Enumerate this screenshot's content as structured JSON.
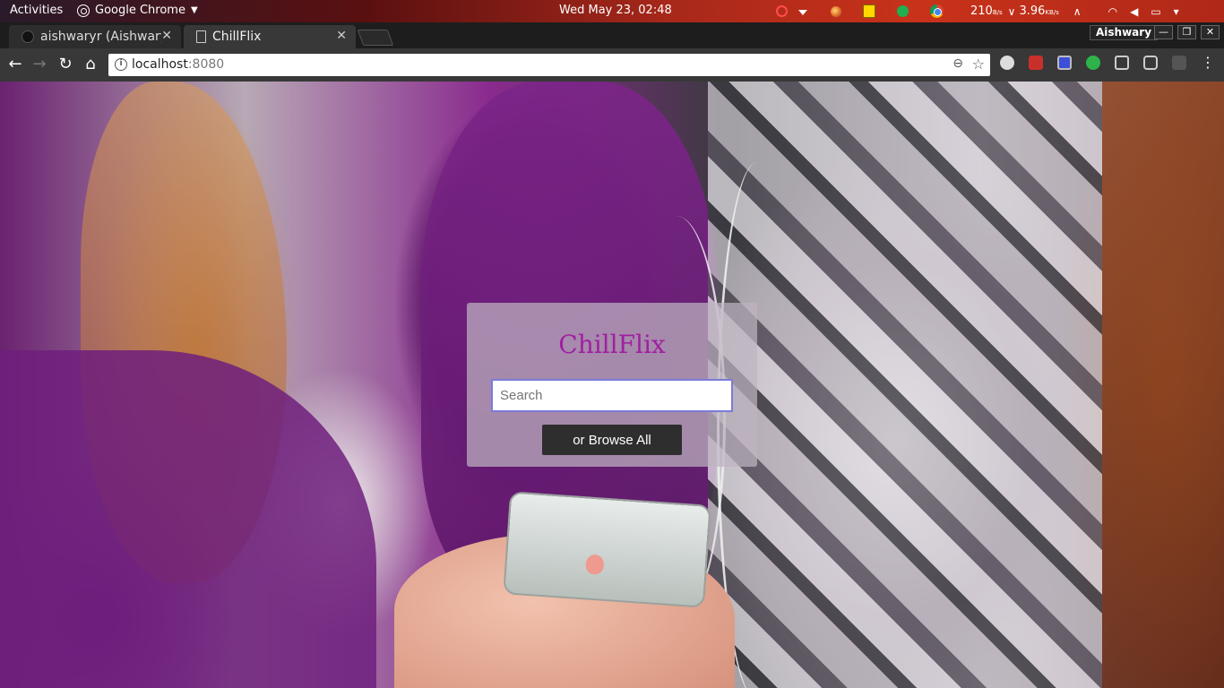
{
  "topbar": {
    "activities": "Activities",
    "app_name": "Google Chrome",
    "clock": "Wed May 23, 02:48",
    "net_down_value": "210",
    "net_down_unit": "B/s",
    "net_up_value": "3.96",
    "net_up_unit": "KB/s"
  },
  "tabs": [
    {
      "title": "aishwaryr (Aishwarya",
      "icon": "github-icon",
      "close": "✕"
    },
    {
      "title": "ChillFlix",
      "icon": "document-icon",
      "close": "✕"
    }
  ],
  "window": {
    "user": "Aishwary",
    "minimize": "—",
    "maximize": "❐",
    "close": "✕"
  },
  "toolbar": {
    "back": "←",
    "forward": "→",
    "reload": "↻",
    "home": "⌂",
    "url_host": "localhost",
    "url_port": ":8080",
    "info": "i",
    "zoom": "⊖",
    "star": "☆",
    "menu": "⋮"
  },
  "page": {
    "brand": "ChillFlix",
    "search_placeholder": "Search",
    "search_value": "",
    "browse_label": "or Browse All"
  },
  "colors": {
    "brand": "#a020a0",
    "search_border": "#7b7bd8",
    "button_bg": "#2e2e2e"
  }
}
